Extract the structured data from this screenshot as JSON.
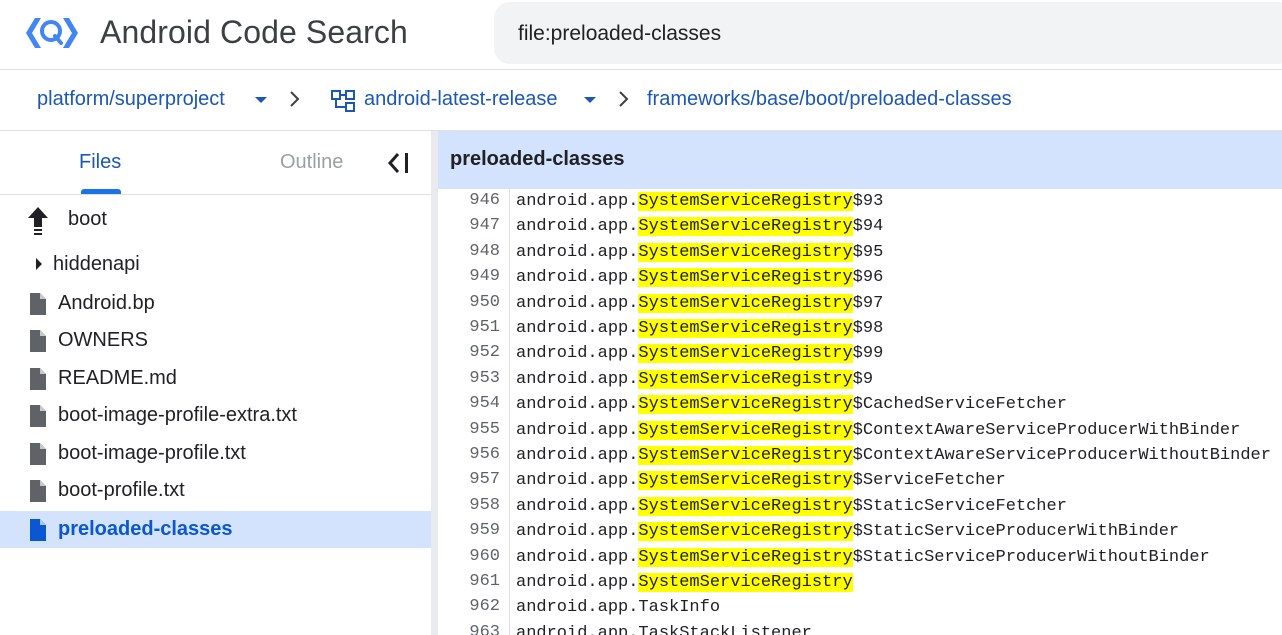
{
  "header": {
    "title": "Android Code Search",
    "search_value": "file:preloaded-classes"
  },
  "breadcrumbs": {
    "project": "platform/superproject",
    "branch": "android-latest-release",
    "path": "frameworks/base/boot/preloaded-classes"
  },
  "sidebar": {
    "tabs": {
      "files": "Files",
      "outline": "Outline"
    },
    "parent_dir": "boot",
    "items": [
      {
        "label": "hiddenapi",
        "type": "folder"
      },
      {
        "label": "Android.bp",
        "type": "file"
      },
      {
        "label": "OWNERS",
        "type": "file"
      },
      {
        "label": "README.md",
        "type": "file"
      },
      {
        "label": "boot-image-profile-extra.txt",
        "type": "file"
      },
      {
        "label": "boot-image-profile.txt",
        "type": "file"
      },
      {
        "label": "boot-profile.txt",
        "type": "file"
      },
      {
        "label": "preloaded-classes",
        "type": "file",
        "selected": true
      }
    ]
  },
  "code": {
    "file_name": "preloaded-classes",
    "lines": [
      {
        "num": "946",
        "prefix": "android.app.",
        "match": "SystemServiceRegistry",
        "suffix": "$93"
      },
      {
        "num": "947",
        "prefix": "android.app.",
        "match": "SystemServiceRegistry",
        "suffix": "$94"
      },
      {
        "num": "948",
        "prefix": "android.app.",
        "match": "SystemServiceRegistry",
        "suffix": "$95"
      },
      {
        "num": "949",
        "prefix": "android.app.",
        "match": "SystemServiceRegistry",
        "suffix": "$96"
      },
      {
        "num": "950",
        "prefix": "android.app.",
        "match": "SystemServiceRegistry",
        "suffix": "$97"
      },
      {
        "num": "951",
        "prefix": "android.app.",
        "match": "SystemServiceRegistry",
        "suffix": "$98"
      },
      {
        "num": "952",
        "prefix": "android.app.",
        "match": "SystemServiceRegistry",
        "suffix": "$99"
      },
      {
        "num": "953",
        "prefix": "android.app.",
        "match": "SystemServiceRegistry",
        "suffix": "$9"
      },
      {
        "num": "954",
        "prefix": "android.app.",
        "match": "SystemServiceRegistry",
        "suffix": "$CachedServiceFetcher"
      },
      {
        "num": "955",
        "prefix": "android.app.",
        "match": "SystemServiceRegistry",
        "suffix": "$ContextAwareServiceProducerWithBinder"
      },
      {
        "num": "956",
        "prefix": "android.app.",
        "match": "SystemServiceRegistry",
        "suffix": "$ContextAwareServiceProducerWithoutBinder"
      },
      {
        "num": "957",
        "prefix": "android.app.",
        "match": "SystemServiceRegistry",
        "suffix": "$ServiceFetcher"
      },
      {
        "num": "958",
        "prefix": "android.app.",
        "match": "SystemServiceRegistry",
        "suffix": "$StaticServiceFetcher"
      },
      {
        "num": "959",
        "prefix": "android.app.",
        "match": "SystemServiceRegistry",
        "suffix": "$StaticServiceProducerWithBinder"
      },
      {
        "num": "960",
        "prefix": "android.app.",
        "match": "SystemServiceRegistry",
        "suffix": "$StaticServiceProducerWithoutBinder"
      },
      {
        "num": "961",
        "prefix": "android.app.",
        "match": "SystemServiceRegistry",
        "suffix": ""
      },
      {
        "num": "962",
        "prefix": "android.app.TaskInfo",
        "match": "",
        "suffix": ""
      },
      {
        "num": "963",
        "prefix": "android.app.TaskStackListener",
        "match": "",
        "suffix": ""
      }
    ]
  },
  "colors": {
    "accent": "#1a57b8",
    "selected_bg": "#d3e3fd",
    "highlight": "#ffff00",
    "logo_blue": "#4285f4"
  },
  "icons": {
    "logo": "code-search-logo",
    "up": "arrow-up-icon",
    "folder_toggle": "caret-right-icon",
    "file": "file-icon",
    "branch": "branch-icon",
    "collapse": "collapse-panel-icon"
  }
}
